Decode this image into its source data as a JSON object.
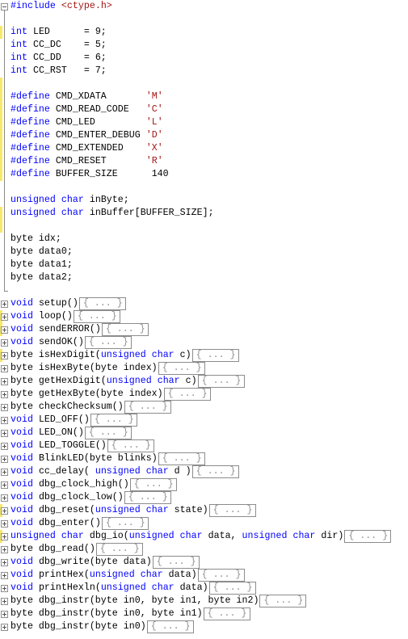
{
  "editor": {
    "lines": [
      {
        "tokens": [
          {
            "t": "pp",
            "v": "#include"
          },
          {
            "t": "txt",
            "v": " "
          },
          {
            "t": "str",
            "v": "<ctype.h>"
          }
        ],
        "fold": "open",
        "mark": false
      },
      {
        "tokens": [],
        "fold": "line",
        "mark": false
      },
      {
        "tokens": [
          {
            "t": "kw",
            "v": "int"
          },
          {
            "t": "txt",
            "v": " LED      = 9;"
          }
        ],
        "fold": "line",
        "mark": true
      },
      {
        "tokens": [
          {
            "t": "kw",
            "v": "int"
          },
          {
            "t": "txt",
            "v": " CC_DC    = 5;"
          }
        ],
        "fold": "line",
        "mark": false
      },
      {
        "tokens": [
          {
            "t": "kw",
            "v": "int"
          },
          {
            "t": "txt",
            "v": " CC_DD    = 6;"
          }
        ],
        "fold": "line",
        "mark": false
      },
      {
        "tokens": [
          {
            "t": "kw",
            "v": "int"
          },
          {
            "t": "txt",
            "v": " CC_RST   = 7;"
          }
        ],
        "fold": "line",
        "mark": false
      },
      {
        "tokens": [],
        "fold": "line",
        "mark": true
      },
      {
        "tokens": [
          {
            "t": "pp",
            "v": "#define"
          },
          {
            "t": "txt",
            "v": " CMD_XDATA       "
          },
          {
            "t": "str",
            "v": "'M'"
          }
        ],
        "fold": "line",
        "mark": true
      },
      {
        "tokens": [
          {
            "t": "pp",
            "v": "#define"
          },
          {
            "t": "txt",
            "v": " CMD_READ_CODE   "
          },
          {
            "t": "str",
            "v": "'C'"
          }
        ],
        "fold": "line",
        "mark": true
      },
      {
        "tokens": [
          {
            "t": "pp",
            "v": "#define"
          },
          {
            "t": "txt",
            "v": " CMD_LED         "
          },
          {
            "t": "str",
            "v": "'L'"
          }
        ],
        "fold": "line",
        "mark": true
      },
      {
        "tokens": [
          {
            "t": "pp",
            "v": "#define"
          },
          {
            "t": "txt",
            "v": " CMD_ENTER_DEBUG "
          },
          {
            "t": "str",
            "v": "'D'"
          }
        ],
        "fold": "line",
        "mark": true
      },
      {
        "tokens": [
          {
            "t": "pp",
            "v": "#define"
          },
          {
            "t": "txt",
            "v": " CMD_EXTENDED    "
          },
          {
            "t": "str",
            "v": "'X'"
          }
        ],
        "fold": "line",
        "mark": true
      },
      {
        "tokens": [
          {
            "t": "pp",
            "v": "#define"
          },
          {
            "t": "txt",
            "v": " CMD_RESET       "
          },
          {
            "t": "str",
            "v": "'R'"
          }
        ],
        "fold": "line",
        "mark": true
      },
      {
        "tokens": [
          {
            "t": "pp",
            "v": "#define"
          },
          {
            "t": "txt",
            "v": " BUFFER_SIZE      140"
          }
        ],
        "fold": "line",
        "mark": true
      },
      {
        "tokens": [],
        "fold": "line",
        "mark": false
      },
      {
        "tokens": [
          {
            "t": "kw",
            "v": "unsigned"
          },
          {
            "t": "txt",
            "v": " "
          },
          {
            "t": "kw",
            "v": "char"
          },
          {
            "t": "txt",
            "v": " inByte;"
          }
        ],
        "fold": "line",
        "mark": false
      },
      {
        "tokens": [
          {
            "t": "kw",
            "v": "unsigned"
          },
          {
            "t": "txt",
            "v": " "
          },
          {
            "t": "kw",
            "v": "char"
          },
          {
            "t": "txt",
            "v": " inBuffer[BUFFER_SIZE];"
          }
        ],
        "fold": "line",
        "mark": true
      },
      {
        "tokens": [],
        "fold": "line",
        "mark": true
      },
      {
        "tokens": [
          {
            "t": "txt",
            "v": "byte idx;"
          }
        ],
        "fold": "line",
        "mark": false
      },
      {
        "tokens": [
          {
            "t": "txt",
            "v": "byte data0;"
          }
        ],
        "fold": "line",
        "mark": false
      },
      {
        "tokens": [
          {
            "t": "txt",
            "v": "byte data1;"
          }
        ],
        "fold": "line",
        "mark": false
      },
      {
        "tokens": [
          {
            "t": "txt",
            "v": "byte data2;"
          }
        ],
        "fold": "line",
        "mark": false
      },
      {
        "tokens": [],
        "fold": "end",
        "mark": false
      },
      {
        "tokens": [
          {
            "t": "kw",
            "v": "void"
          },
          {
            "t": "txt",
            "v": " setup()"
          }
        ],
        "fold": "closed",
        "mark": false
      },
      {
        "tokens": [
          {
            "t": "kw",
            "v": "void"
          },
          {
            "t": "txt",
            "v": " loop()"
          }
        ],
        "fold": "closed",
        "mark": true
      },
      {
        "tokens": [
          {
            "t": "kw",
            "v": "void"
          },
          {
            "t": "txt",
            "v": " sendERROR()"
          }
        ],
        "fold": "closed",
        "mark": true
      },
      {
        "tokens": [
          {
            "t": "kw",
            "v": "void"
          },
          {
            "t": "txt",
            "v": " sendOK()"
          }
        ],
        "fold": "closed",
        "mark": false
      },
      {
        "tokens": [
          {
            "t": "txt",
            "v": "byte isHexDigit("
          },
          {
            "t": "kw",
            "v": "unsigned"
          },
          {
            "t": "txt",
            "v": " "
          },
          {
            "t": "kw",
            "v": "char"
          },
          {
            "t": "txt",
            "v": " c)"
          }
        ],
        "fold": "closed",
        "mark": true
      },
      {
        "tokens": [
          {
            "t": "txt",
            "v": "byte isHexByte(byte index)"
          }
        ],
        "fold": "closed",
        "mark": false
      },
      {
        "tokens": [
          {
            "t": "txt",
            "v": "byte getHexDigit("
          },
          {
            "t": "kw",
            "v": "unsigned"
          },
          {
            "t": "txt",
            "v": " "
          },
          {
            "t": "kw",
            "v": "char"
          },
          {
            "t": "txt",
            "v": " c)"
          }
        ],
        "fold": "closed",
        "mark": false
      },
      {
        "tokens": [
          {
            "t": "txt",
            "v": "byte getHexByte(byte index)"
          }
        ],
        "fold": "closed",
        "mark": false
      },
      {
        "tokens": [
          {
            "t": "txt",
            "v": "byte checkChecksum()"
          }
        ],
        "fold": "closed",
        "mark": false
      },
      {
        "tokens": [
          {
            "t": "kw",
            "v": "void"
          },
          {
            "t": "txt",
            "v": " LED_OFF()"
          }
        ],
        "fold": "closed",
        "mark": false
      },
      {
        "tokens": [
          {
            "t": "kw",
            "v": "void"
          },
          {
            "t": "txt",
            "v": " LED_ON()"
          }
        ],
        "fold": "closed",
        "mark": false
      },
      {
        "tokens": [
          {
            "t": "kw",
            "v": "void"
          },
          {
            "t": "txt",
            "v": " LED_TOGGLE()"
          }
        ],
        "fold": "closed",
        "mark": false
      },
      {
        "tokens": [
          {
            "t": "kw",
            "v": "void"
          },
          {
            "t": "txt",
            "v": " BlinkLED(byte blinks)"
          }
        ],
        "fold": "closed",
        "mark": false
      },
      {
        "tokens": [
          {
            "t": "kw",
            "v": "void"
          },
          {
            "t": "txt",
            "v": " cc_delay( "
          },
          {
            "t": "kw",
            "v": "unsigned"
          },
          {
            "t": "txt",
            "v": " "
          },
          {
            "t": "kw",
            "v": "char"
          },
          {
            "t": "txt",
            "v": " d )"
          }
        ],
        "fold": "closed",
        "mark": false
      },
      {
        "tokens": [
          {
            "t": "kw",
            "v": "void"
          },
          {
            "t": "txt",
            "v": " dbg_clock_high()"
          }
        ],
        "fold": "closed",
        "mark": false
      },
      {
        "tokens": [
          {
            "t": "kw",
            "v": "void"
          },
          {
            "t": "txt",
            "v": " dbg_clock_low()"
          }
        ],
        "fold": "closed",
        "mark": false
      },
      {
        "tokens": [
          {
            "t": "kw",
            "v": "void"
          },
          {
            "t": "txt",
            "v": " dbg_reset("
          },
          {
            "t": "kw",
            "v": "unsigned"
          },
          {
            "t": "txt",
            "v": " "
          },
          {
            "t": "kw",
            "v": "char"
          },
          {
            "t": "txt",
            "v": " state)"
          }
        ],
        "fold": "closed",
        "mark": true
      },
      {
        "tokens": [
          {
            "t": "kw",
            "v": "void"
          },
          {
            "t": "txt",
            "v": " dbg_enter()"
          }
        ],
        "fold": "closed",
        "mark": false
      },
      {
        "tokens": [
          {
            "t": "kw",
            "v": "unsigned"
          },
          {
            "t": "txt",
            "v": " "
          },
          {
            "t": "kw",
            "v": "char"
          },
          {
            "t": "txt",
            "v": " dbg_io("
          },
          {
            "t": "kw",
            "v": "unsigned"
          },
          {
            "t": "txt",
            "v": " "
          },
          {
            "t": "kw",
            "v": "char"
          },
          {
            "t": "txt",
            "v": " data, "
          },
          {
            "t": "kw",
            "v": "unsigned"
          },
          {
            "t": "txt",
            "v": " "
          },
          {
            "t": "kw",
            "v": "char"
          },
          {
            "t": "txt",
            "v": " dir)"
          }
        ],
        "fold": "closed",
        "mark": true
      },
      {
        "tokens": [
          {
            "t": "txt",
            "v": "byte dbg_read()"
          }
        ],
        "fold": "closed",
        "mark": false
      },
      {
        "tokens": [
          {
            "t": "kw",
            "v": "void"
          },
          {
            "t": "txt",
            "v": " dbg_write(byte data)"
          }
        ],
        "fold": "closed",
        "mark": false
      },
      {
        "tokens": [
          {
            "t": "kw",
            "v": "void"
          },
          {
            "t": "txt",
            "v": " printHex("
          },
          {
            "t": "kw",
            "v": "unsigned"
          },
          {
            "t": "txt",
            "v": " "
          },
          {
            "t": "kw",
            "v": "char"
          },
          {
            "t": "txt",
            "v": " data)"
          }
        ],
        "fold": "closed",
        "mark": false
      },
      {
        "tokens": [
          {
            "t": "kw",
            "v": "void"
          },
          {
            "t": "txt",
            "v": " printHexln("
          },
          {
            "t": "kw",
            "v": "unsigned"
          },
          {
            "t": "txt",
            "v": " "
          },
          {
            "t": "kw",
            "v": "char"
          },
          {
            "t": "txt",
            "v": " data)"
          }
        ],
        "fold": "closed",
        "mark": false
      },
      {
        "tokens": [
          {
            "t": "txt",
            "v": "byte dbg_instr(byte in0, byte in1, byte in2)"
          }
        ],
        "fold": "closed",
        "mark": false
      },
      {
        "tokens": [
          {
            "t": "txt",
            "v": "byte dbg_instr(byte in0, byte in1)"
          }
        ],
        "fold": "closed",
        "mark": false
      },
      {
        "tokens": [
          {
            "t": "txt",
            "v": "byte dbg_instr(byte in0)"
          }
        ],
        "fold": "closed",
        "mark": false
      }
    ],
    "collapsed_label": "{ ... }",
    "colors": {
      "keyword": "#0000ff",
      "string": "#a31515",
      "text": "#000000",
      "change_marker": "#f7e86a"
    }
  }
}
